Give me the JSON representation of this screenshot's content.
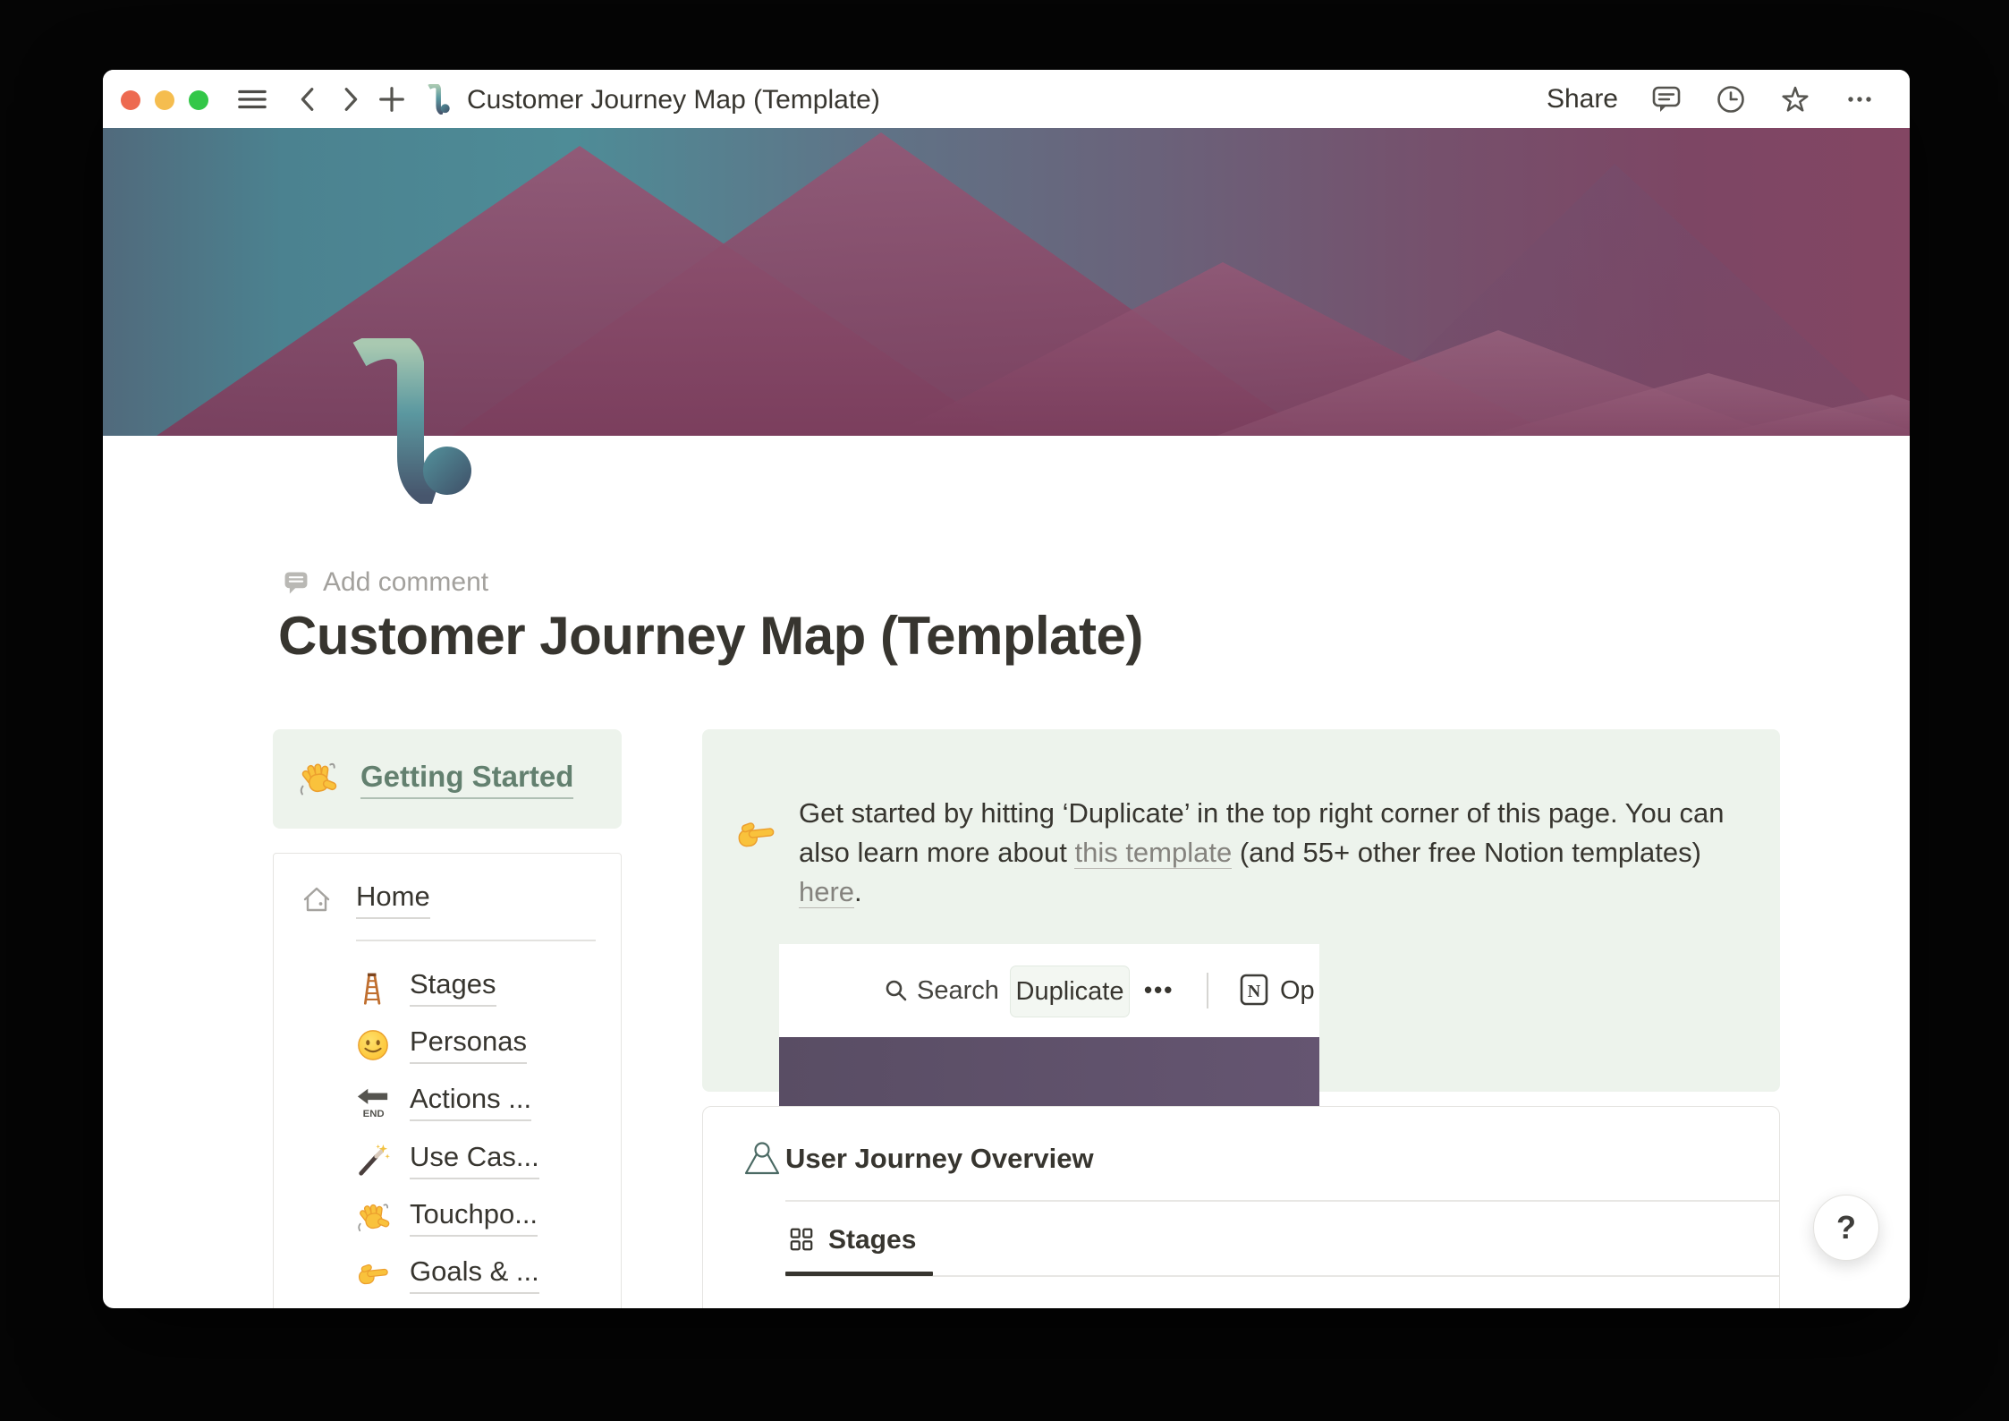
{
  "titlebar": {
    "title": "Customer Journey Map (Template)",
    "share": "Share"
  },
  "page": {
    "add_comment": "Add comment",
    "title": "Customer Journey Map (Template)"
  },
  "getting_started": {
    "icon": "waving-hand-emoji",
    "label": "Getting Started"
  },
  "nav": {
    "home": {
      "icon": "house-icon",
      "label": "Home"
    },
    "items": [
      {
        "icon": "ladder-emoji",
        "label": "Stages"
      },
      {
        "icon": "slightly-smiling-face-emoji",
        "label": "Personas"
      },
      {
        "icon": "end-arrow-emoji",
        "label": "Actions ..."
      },
      {
        "icon": "magic-wand-emoji",
        "label": "Use Cas..."
      },
      {
        "icon": "waving-hand-emoji",
        "label": "Touchpo..."
      },
      {
        "icon": "pointing-right-emoji",
        "label": "Goals & ..."
      }
    ]
  },
  "callout": {
    "icon": "pointing-right-emoji",
    "text_1": "Get started by hitting ‘Duplicate’ in the top right corner of this page. You can also learn more about ",
    "link_template": "this template",
    "text_2": " (and 55+ other free Notion templates) ",
    "link_here": "here",
    "text_3": "."
  },
  "embed": {
    "search": "Search",
    "duplicate": "Duplicate",
    "more": "•••",
    "open": "Op",
    "notion_letter": "N"
  },
  "overview": {
    "title": "User Journey Overview",
    "tab_stages": "Stages"
  },
  "help": "?",
  "colors": {
    "callout_bg": "#edf3ec",
    "green_text": "#63806f",
    "cover_teal": "#4e8c97",
    "cover_maroon": "#7d4260",
    "embed_purple_left": "#594d64",
    "embed_purple_right": "#655571"
  }
}
